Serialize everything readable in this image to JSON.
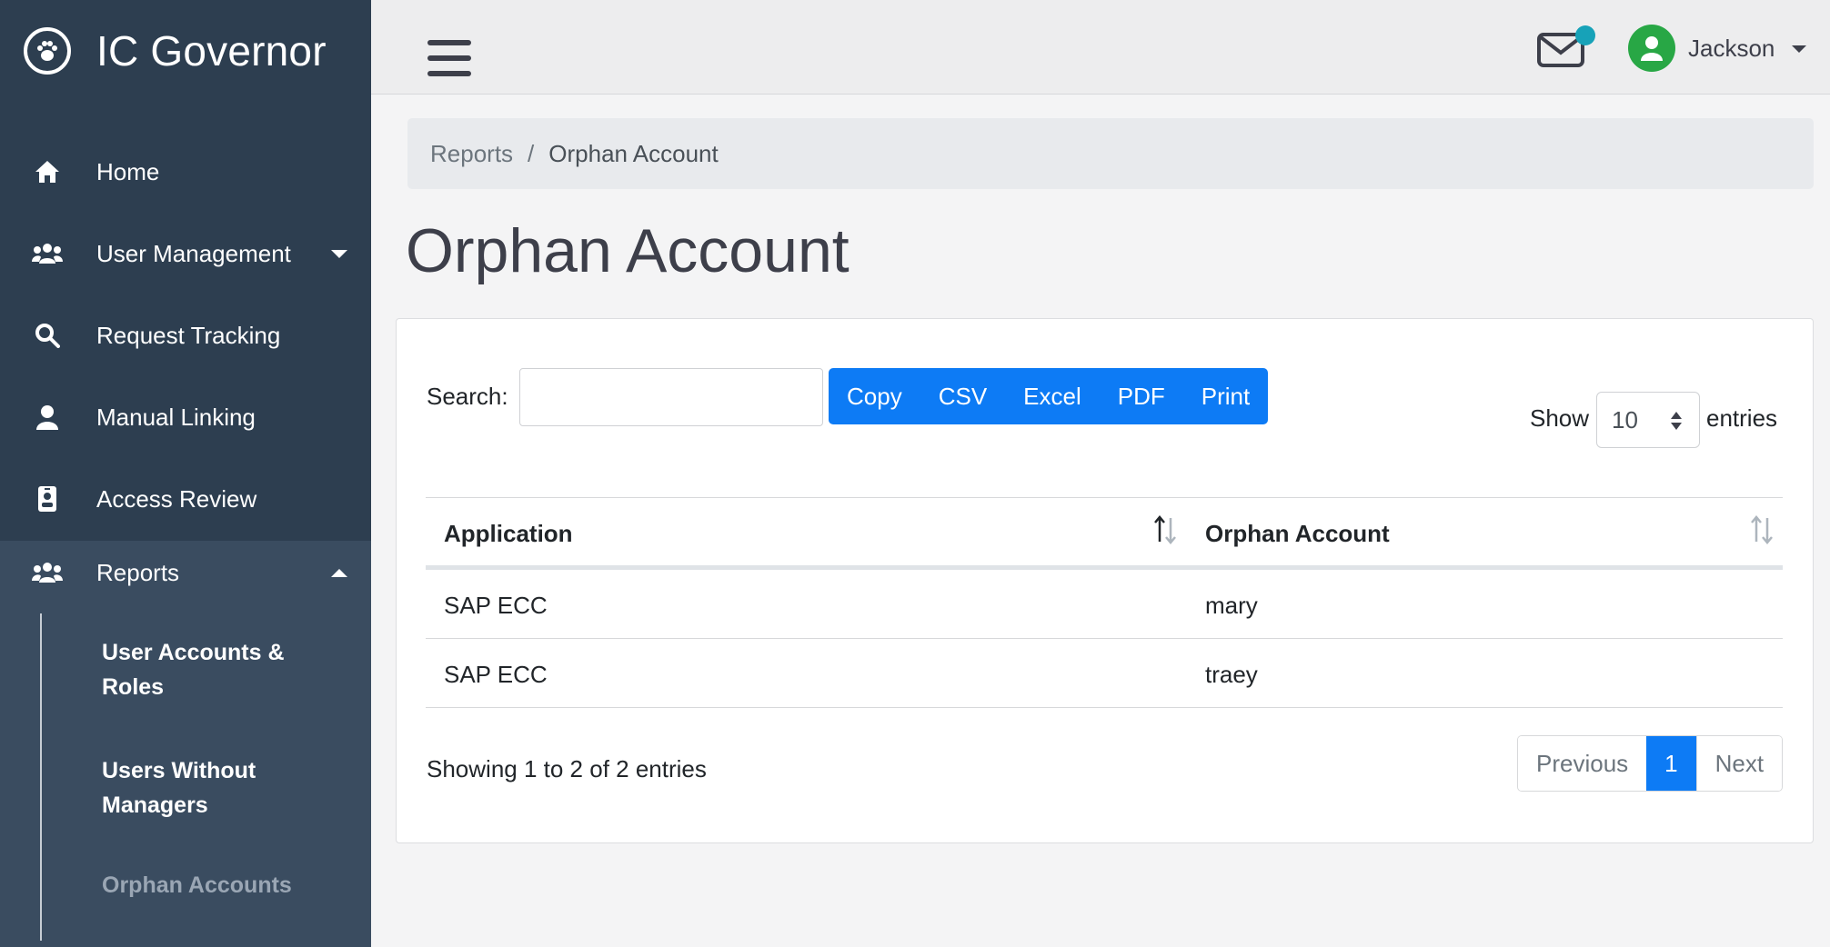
{
  "brand": {
    "title": "IC Governor"
  },
  "sidebar": {
    "items": [
      {
        "label": "Home",
        "icon": "home-icon"
      },
      {
        "label": "User Management",
        "icon": "users-icon"
      },
      {
        "label": "Request Tracking",
        "icon": "search-icon"
      },
      {
        "label": "Manual Linking",
        "icon": "user-icon"
      },
      {
        "label": "Access Review",
        "icon": "id-badge-icon"
      }
    ],
    "reports": {
      "label": "Reports",
      "icon": "users-icon",
      "subitems": [
        {
          "label": "User Accounts & Roles"
        },
        {
          "label": "Users Without Managers"
        },
        {
          "label": "Orphan Accounts"
        }
      ]
    }
  },
  "topbar": {
    "user_name": "Jackson"
  },
  "breadcrumb": {
    "parent": "Reports",
    "separator": "/",
    "current": "Orphan Account"
  },
  "page": {
    "title": "Orphan Account"
  },
  "toolbar": {
    "search_label": "Search:",
    "search_value": "",
    "buttons": [
      "Copy",
      "CSV",
      "Excel",
      "PDF",
      "Print"
    ],
    "show_label": "Show",
    "show_value": "10",
    "entries_label": "entries"
  },
  "table": {
    "columns": [
      "Application",
      "Orphan Account"
    ],
    "rows": [
      [
        "SAP ECC",
        "mary"
      ],
      [
        "SAP ECC",
        "traey"
      ]
    ]
  },
  "footer": {
    "info": "Showing 1 to 2 of 2 entries",
    "prev": "Previous",
    "current_page": "1",
    "next": "Next"
  },
  "colors": {
    "sidebar": "#2d3e50",
    "primary": "#0d7bf5",
    "avatar": "#28a745",
    "badge": "#17a2b8"
  }
}
